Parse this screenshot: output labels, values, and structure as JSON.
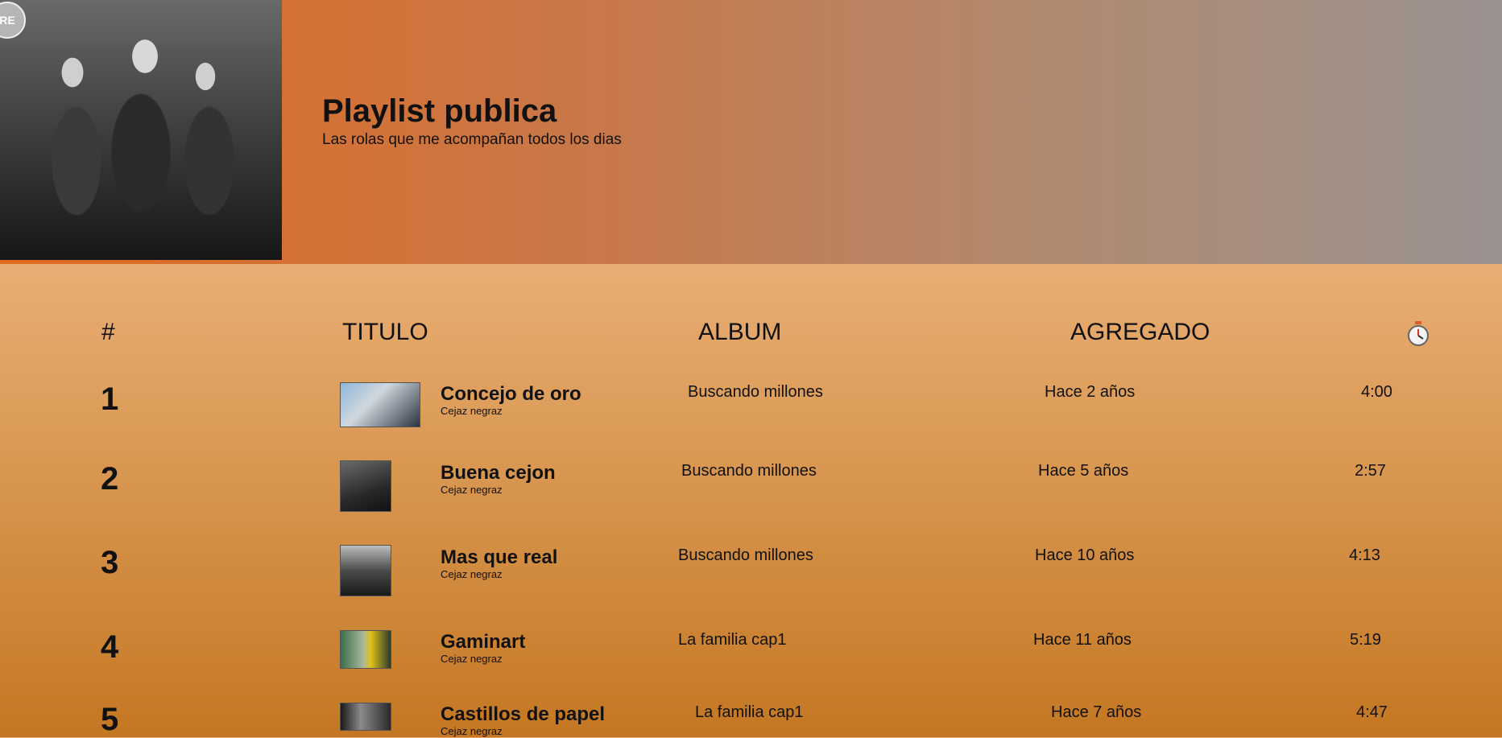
{
  "playlist": {
    "title": "Playlist publica",
    "description": "Las rolas que me acompañan todos los dias",
    "cover_sign_text": "RE"
  },
  "columns": {
    "number": "#",
    "title": "TITULO",
    "album": "ALBUM",
    "added": "AGREGADO",
    "duration_icon": "stopwatch-icon"
  },
  "tracks": [
    {
      "number": "1",
      "title": "Concejo de oro",
      "artist": "Cejaz negraz",
      "album": "Buscando millones",
      "added": "Hace 2 años",
      "duration": "4:00"
    },
    {
      "number": "2",
      "title": "Buena cejon",
      "artist": "Cejaz negraz",
      "album": "Buscando millones",
      "added": "Hace 5 años",
      "duration": "2:57"
    },
    {
      "number": "3",
      "title": "Mas que real",
      "artist": "Cejaz negraz",
      "album": "Buscando millones",
      "added": "Hace 10 años",
      "duration": "4:13"
    },
    {
      "number": "4",
      "title": "Gaminart",
      "artist": "Cejaz negraz",
      "album": "La familia cap1",
      "added": "Hace 11 años",
      "duration": "5:19"
    },
    {
      "number": "5",
      "title": "Castillos de papel",
      "artist": "Cejaz negraz",
      "album": "La familia cap1",
      "added": "Hace 7 años",
      "duration": "4:47"
    }
  ],
  "colors": {
    "header_start": "#e06a1e",
    "header_end": "#9a9190",
    "list_top": "#e9ae74",
    "list_bottom": "#c47722"
  }
}
